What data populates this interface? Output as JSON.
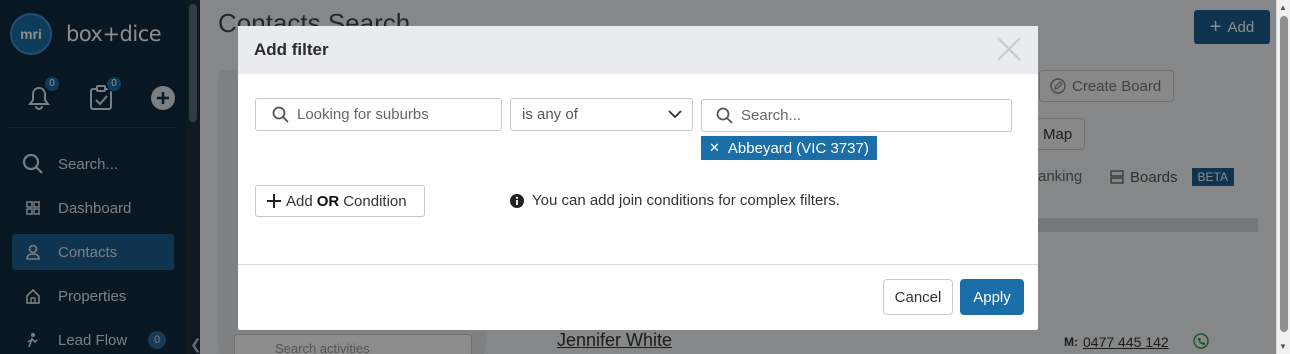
{
  "sidebar": {
    "logo_text": "mri",
    "brand": "box+dice",
    "notifications_count": "0",
    "tasks_count": "0",
    "items": [
      {
        "label": "Search..."
      },
      {
        "label": "Dashboard"
      },
      {
        "label": "Contacts"
      },
      {
        "label": "Properties"
      },
      {
        "label": "Lead Flow",
        "count": "0"
      }
    ]
  },
  "background": {
    "page_title": "Contacts Search",
    "add_label": "Add",
    "create_board_label": "Create Board",
    "map_label": "Map",
    "ranking_label": "anking",
    "boards_label": "Boards",
    "beta_label": "BETA",
    "search_activities_placeholder": "Search activities",
    "contact_name": "Jennifer White",
    "phone_label": "M:",
    "phone": "0477 445 142"
  },
  "modal": {
    "title": "Add filter",
    "field_placeholder": "Looking for suburbs",
    "operator_value": "is any of",
    "search_placeholder": "Search...",
    "tags": [
      "Abbeyard (VIC 3737)"
    ],
    "add_prefix": "Add",
    "add_or": "OR",
    "add_suffix": "Condition",
    "info_text": "You can add join conditions for complex filters.",
    "cancel_label": "Cancel",
    "apply_label": "Apply"
  },
  "colors": {
    "sidebar_bg": "#0f2a3d",
    "accent": "#1b6fa8",
    "overlay": "rgba(0,0,0,0.45)"
  }
}
